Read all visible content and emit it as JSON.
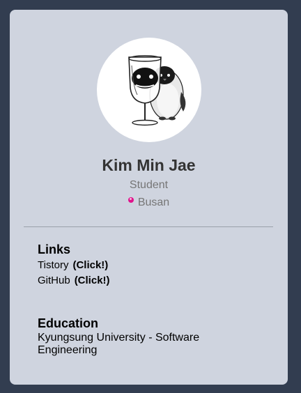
{
  "profile": {
    "name": "Kim Min Jae",
    "role": "Student",
    "location": "Busan",
    "avatar_icon": "penguin-with-wine-glass-icon"
  },
  "links": {
    "title": "Links",
    "items": [
      {
        "label": "Tistory",
        "action": "(Click!)"
      },
      {
        "label": "GitHub",
        "action": "(Click!)"
      }
    ]
  },
  "education": {
    "title": "Education",
    "text": "Kyungsung University - Software Engineering"
  },
  "colors": {
    "background": "#323d50",
    "card": "#cfd4df",
    "pin": "#e0138c"
  }
}
